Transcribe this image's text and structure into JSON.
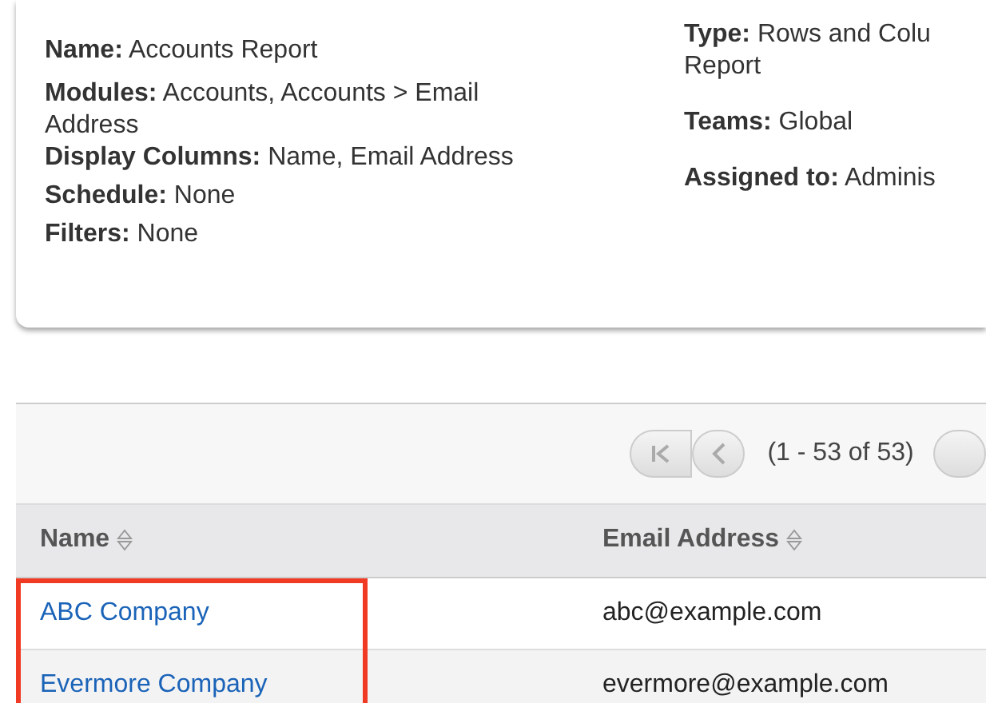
{
  "details": {
    "left": [
      {
        "label": "Name:",
        "value": [
          "Accounts Report"
        ]
      },
      {
        "label": "Modules:",
        "value": [
          "Accounts, Accounts > Email",
          "Address"
        ]
      },
      {
        "label": "Display Columns:",
        "value": [
          "Name, Email Address"
        ]
      },
      {
        "label": "Schedule:",
        "value": [
          "None"
        ]
      },
      {
        "label": "Filters:",
        "value": [
          "None"
        ]
      }
    ],
    "right": [
      {
        "label": "Type:",
        "value": [
          "Rows and Colu",
          "Report"
        ]
      },
      {
        "label": "Teams:",
        "value": [
          "Global"
        ]
      },
      {
        "label": "Assigned to:",
        "value": [
          "Adminis"
        ]
      }
    ]
  },
  "pagination": {
    "range": "(1 - 53 of 53)"
  },
  "table": {
    "columns": [
      {
        "label": "Name"
      },
      {
        "label": "Email Address"
      }
    ],
    "rows": [
      {
        "name": "ABC Company",
        "email": "abc@example.com",
        "highlighted": true
      },
      {
        "name": "Evermore Company",
        "email": "evermore@example.com",
        "highlighted": true
      }
    ]
  }
}
